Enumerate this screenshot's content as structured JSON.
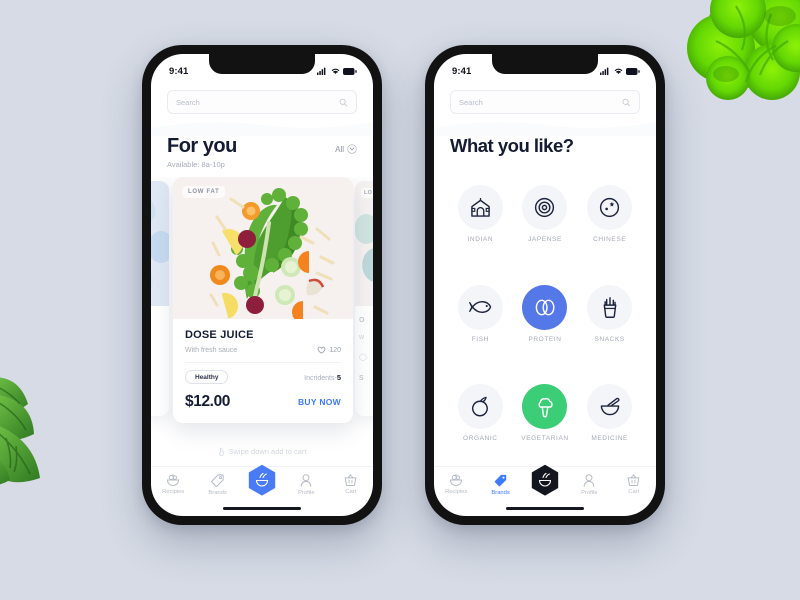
{
  "theme": {
    "page_background": "#d6dbe5",
    "accent_blue": "#5578e8",
    "link_blue": "#3d7bfb",
    "accent_green": "#3ccd77",
    "dark": "#141b33",
    "muted": "#a4a9b6"
  },
  "decor": [
    {
      "name": "lettuce",
      "position": "top-right",
      "color": "#5fd401"
    },
    {
      "name": "basil",
      "position": "bottom-left",
      "color": "#4faa33"
    }
  ],
  "phone_one": {
    "status": {
      "time": "9:41",
      "icons": [
        "signal-icon",
        "wifi-icon",
        "battery-icon"
      ]
    },
    "search": {
      "placeholder": "Search",
      "value": "",
      "icon": "search-icon"
    },
    "header": {
      "title": "For you",
      "filter_label": "All",
      "filter_icon": "chevron-down-circle-icon",
      "subtitle": "Available: 8a-10p"
    },
    "card": {
      "badge": "LOW FAT",
      "title": "DOSE JUICE",
      "subtitle": "With fresh sauce",
      "likes": "120",
      "likes_icon": "heart-icon",
      "tag": "Healthy",
      "incredients_label": "Incridents-",
      "incredients_value": "5",
      "price": "$12.00",
      "buy_label": "BUY NOW"
    },
    "peek_left": {
      "badge": "",
      "likes": "0",
      "incredients": "3",
      "buy_label": "W"
    },
    "peek_right": {
      "badge": "LO"
    },
    "swipe_hint": "Swipe down add to cart",
    "swipe_icon": "hand-swipe-icon",
    "tabs": [
      {
        "label": "Recipies",
        "icon": "bowl-salad-icon",
        "active": false
      },
      {
        "label": "Brands",
        "icon": "tag-icon",
        "active": false
      },
      {
        "label": "",
        "icon": "hexagon-bowl-icon",
        "active": true,
        "center": true,
        "style": "blue"
      },
      {
        "label": "Profile",
        "icon": "person-icon",
        "active": false
      },
      {
        "label": "Cart",
        "icon": "basket-icon",
        "active": false
      }
    ]
  },
  "phone_two": {
    "status": {
      "time": "9:41",
      "icons": [
        "signal-icon",
        "wifi-icon",
        "battery-icon"
      ]
    },
    "search": {
      "placeholder": "Search",
      "value": "",
      "icon": "search-icon"
    },
    "header": {
      "title": "What you like?"
    },
    "categories": [
      {
        "label": "INDIAN",
        "icon": "temple-icon",
        "state": "default"
      },
      {
        "label": "JAPENSE",
        "icon": "circles-icon",
        "state": "default"
      },
      {
        "label": "CHINESE",
        "icon": "moon-star-icon",
        "state": "default"
      },
      {
        "label": "FISH",
        "icon": "fish-icon",
        "state": "default"
      },
      {
        "label": "PROTEIN",
        "icon": "eggs-icon",
        "state": "selected-blue"
      },
      {
        "label": "SNACKS",
        "icon": "fries-icon",
        "state": "default"
      },
      {
        "label": "ORGANIC",
        "icon": "fruit-icon",
        "state": "default"
      },
      {
        "label": "VEGETARIAN",
        "icon": "broccoli-icon",
        "state": "selected-green"
      },
      {
        "label": "MEDICINE",
        "icon": "mortar-icon",
        "state": "default"
      }
    ],
    "tabs": [
      {
        "label": "Recipies",
        "icon": "bowl-salad-icon",
        "active": false
      },
      {
        "label": "Brands",
        "icon": "tag-icon",
        "active": true
      },
      {
        "label": "",
        "icon": "hexagon-bowl-icon",
        "active": true,
        "center": true,
        "style": "dark"
      },
      {
        "label": "Profile",
        "icon": "person-icon",
        "active": false
      },
      {
        "label": "Cart",
        "icon": "basket-icon",
        "active": false
      }
    ]
  }
}
